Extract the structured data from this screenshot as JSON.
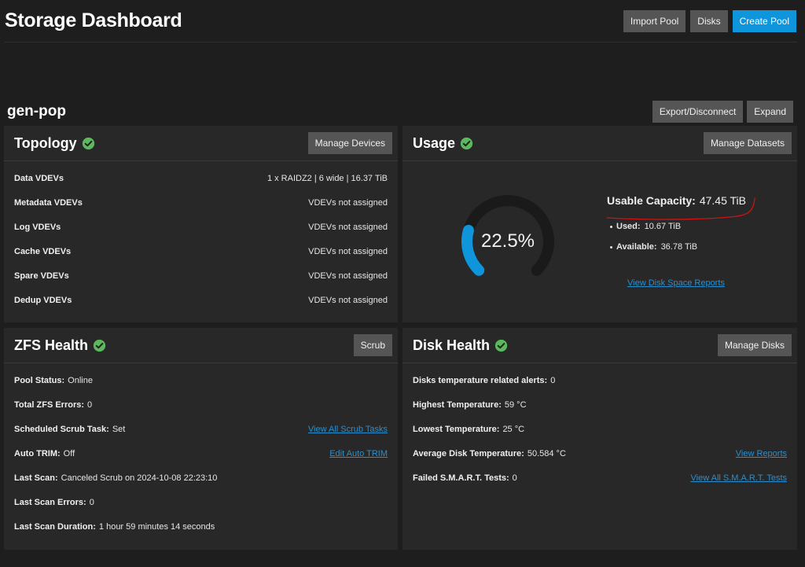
{
  "page": {
    "title": "Storage Dashboard",
    "buttons": {
      "import_pool": "Import Pool",
      "disks": "Disks",
      "create_pool": "Create Pool"
    }
  },
  "pool": {
    "name": "gen-pop",
    "buttons": {
      "export": "Export/Disconnect",
      "expand": "Expand"
    }
  },
  "topology": {
    "title": "Topology",
    "button": "Manage Devices",
    "rows": [
      {
        "label": "Data VDEVs",
        "value": "1 x RAIDZ2 | 6 wide | 16.37 TiB"
      },
      {
        "label": "Metadata VDEVs",
        "value": "VDEVs not assigned"
      },
      {
        "label": "Log VDEVs",
        "value": "VDEVs not assigned"
      },
      {
        "label": "Cache VDEVs",
        "value": "VDEVs not assigned"
      },
      {
        "label": "Spare VDEVs",
        "value": "VDEVs not assigned"
      },
      {
        "label": "Dedup VDEVs",
        "value": "VDEVs not assigned"
      }
    ]
  },
  "usage": {
    "title": "Usage",
    "button": "Manage Datasets",
    "percent_text": "22.5%",
    "percent_value": 22.5,
    "capacity_label": "Usable Capacity:",
    "capacity_value": "47.45 TiB",
    "used_label": "Used:",
    "used_value": "10.67 TiB",
    "available_label": "Available:",
    "available_value": "36.78 TiB",
    "link": "View Disk Space Reports",
    "colors": {
      "arc_used": "#0f95dc",
      "arc_track": "#1a1a1a",
      "annotation": "#d01212"
    }
  },
  "zfs": {
    "title": "ZFS Health",
    "button": "Scrub",
    "rows": [
      {
        "label": "Pool Status:",
        "value": "Online",
        "link": ""
      },
      {
        "label": "Total ZFS Errors:",
        "value": "0",
        "link": ""
      },
      {
        "label": "Scheduled Scrub Task:",
        "value": "Set",
        "link": "View All Scrub Tasks"
      },
      {
        "label": "Auto TRIM:",
        "value": "Off",
        "link": "Edit Auto TRIM"
      },
      {
        "label": "Last Scan:",
        "value": "Canceled Scrub on 2024-10-08 22:23:10",
        "link": ""
      },
      {
        "label": "Last Scan Errors:",
        "value": "0",
        "link": ""
      },
      {
        "label": "Last Scan Duration:",
        "value": "1 hour 59 minutes 14 seconds",
        "link": ""
      }
    ]
  },
  "disk_health": {
    "title": "Disk Health",
    "button": "Manage Disks",
    "rows": [
      {
        "label": "Disks temperature related alerts:",
        "value": "0",
        "link": ""
      },
      {
        "label": "Highest Temperature:",
        "value": "59 °C",
        "link": ""
      },
      {
        "label": "Lowest Temperature:",
        "value": "25 °C",
        "link": ""
      },
      {
        "label": "Average Disk Temperature:",
        "value": "50.584 °C",
        "link": "View Reports"
      },
      {
        "label": "Failed S.M.A.R.T. Tests:",
        "value": "0",
        "link": "View All S.M.A.R.T. Tests"
      }
    ]
  },
  "status_color": "#5cb85c"
}
